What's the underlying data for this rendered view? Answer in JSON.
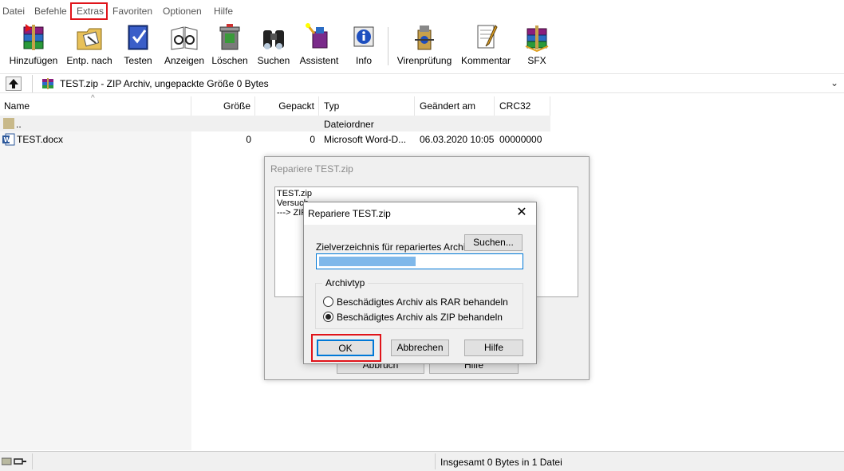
{
  "menu": {
    "items": [
      "Datei",
      "Befehle",
      "Extras",
      "Favoriten",
      "Optionen",
      "Hilfe"
    ],
    "highlighted": "Extras"
  },
  "toolbar": {
    "buttons": [
      {
        "label": "Hinzufügen",
        "icon": "add-archive-icon"
      },
      {
        "label": "Entp. nach",
        "icon": "extract-icon"
      },
      {
        "label": "Testen",
        "icon": "test-icon"
      },
      {
        "label": "Anzeigen",
        "icon": "view-icon"
      },
      {
        "label": "Löschen",
        "icon": "delete-icon"
      },
      {
        "label": "Suchen",
        "icon": "find-icon"
      },
      {
        "label": "Assistent",
        "icon": "wizard-icon"
      },
      {
        "label": "Info",
        "icon": "info-icon"
      },
      {
        "label": "Virenprüfung",
        "icon": "virus-scan-icon"
      },
      {
        "label": "Kommentar",
        "icon": "comment-icon"
      },
      {
        "label": "SFX",
        "icon": "sfx-icon"
      }
    ]
  },
  "address": {
    "text": "TEST.zip - ZIP Archiv, ungepackte Größe 0 Bytes"
  },
  "filelist": {
    "columns": [
      "Name",
      "Größe",
      "Gepackt",
      "Typ",
      "Geändert am",
      "CRC32"
    ],
    "rows": [
      {
        "name": "..",
        "size": "",
        "packed": "",
        "type": "Dateiordner",
        "modified": "",
        "crc": ""
      },
      {
        "name": "TEST.docx",
        "size": "0",
        "packed": "0",
        "type": "Microsoft Word-D...",
        "modified": "06.03.2020 10:05",
        "crc": "00000000"
      }
    ]
  },
  "status": {
    "text": "Insgesamt 0 Bytes in 1 Datei"
  },
  "bg_dialog": {
    "title": "Repariere TEST.zip",
    "log": [
      "TEST.zip",
      "Versuch",
      "---> ZIP"
    ],
    "buttons": [
      "Abbruch",
      "Hilfe"
    ]
  },
  "repair_dialog": {
    "title": "Repariere TEST.zip",
    "close_glyph": "✕",
    "dest_label": "Zielverzeichnis für repariertes Archiv",
    "browse_label": "Suchen...",
    "dest_value": "",
    "group_label": "Archivtyp",
    "radio_rar": "Beschädigtes Archiv als RAR behandeln",
    "radio_zip": "Beschädigtes Archiv als ZIP behandeln",
    "selected": "zip",
    "ok_label": "OK",
    "cancel_label": "Abbrechen",
    "help_label": "Hilfe"
  },
  "colors": {
    "highlight_border": "#e0141a",
    "selection_blue": "#0078d7"
  }
}
